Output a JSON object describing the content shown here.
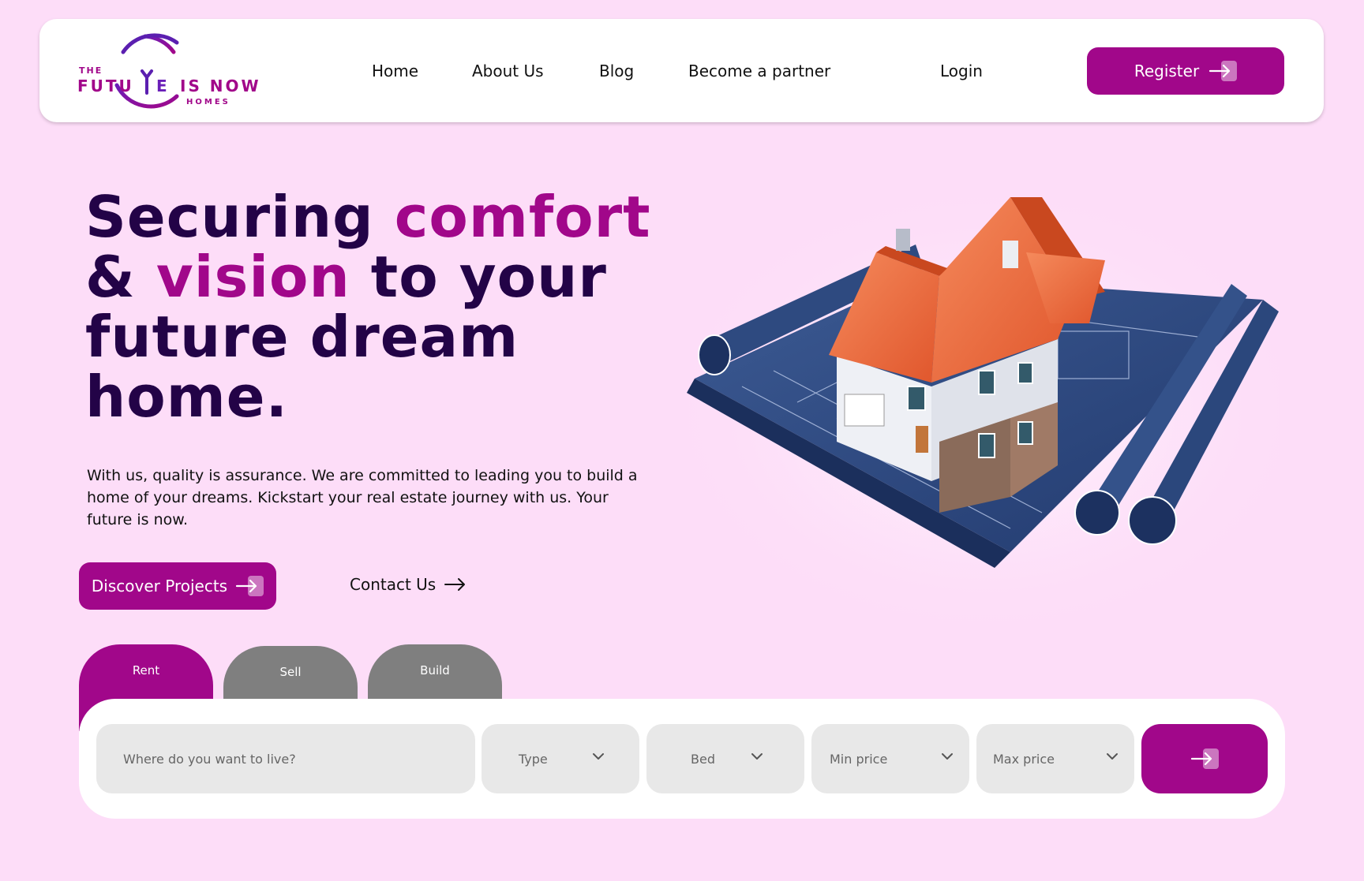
{
  "brand": {
    "logo_the": "THE",
    "logo_future": "FUTU",
    "logo_e": "E",
    "logo_is_now": "IS NOW",
    "logo_homes": "HOMES",
    "logo_alt": "The Future Is Now Homes",
    "primary_color": "#a1078a",
    "dark_color": "#230347",
    "background_color": "#fdddf8"
  },
  "nav": {
    "home": "Home",
    "about": "About Us",
    "blog": "Blog",
    "partner": "Become a partner",
    "login": "Login",
    "register": "Register"
  },
  "hero": {
    "headline_part1": "Securing ",
    "headline_accent1": "comfort",
    "headline_part2": "& ",
    "headline_accent2": "vision",
    "headline_part3": " to your",
    "headline_part4": "future dream",
    "headline_part5": "home.",
    "subtext": "With us, quality is assurance. We are committed to leading you to build a home of your dreams. Kickstart your real estate journey with us. Your future is now.",
    "discover_label": "Discover Projects",
    "contact_label": "Contact Us",
    "image_alt": "House on architectural blueprints"
  },
  "search": {
    "tabs": [
      {
        "label": "Rent",
        "active": true
      },
      {
        "label": "Sell",
        "active": false
      },
      {
        "label": "Build",
        "active": false
      }
    ],
    "location_placeholder": "Where do you want to live?",
    "type_label": "Type",
    "bed_label": "Bed",
    "min_price_label": "Min price",
    "max_price_label": "Max price"
  }
}
